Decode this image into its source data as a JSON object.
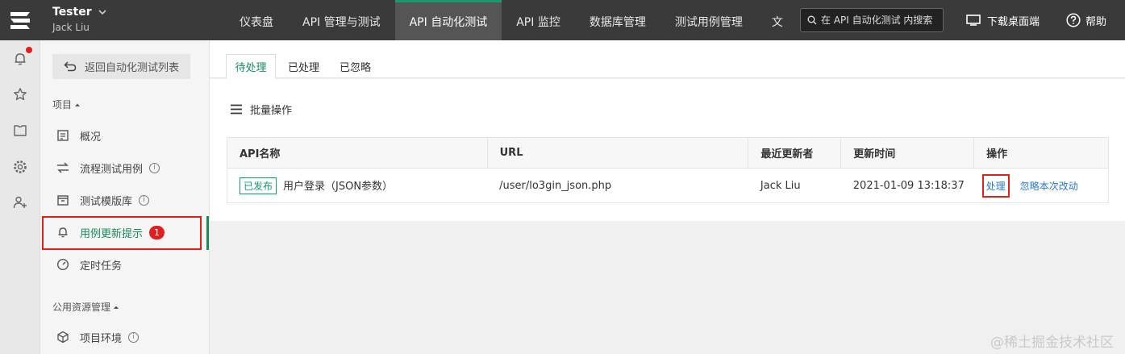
{
  "header": {
    "space_name": "Tester",
    "space_user": "Jack Liu",
    "nav": [
      "仪表盘",
      "API 管理与测试",
      "API 自动化测试",
      "API 监控",
      "数据库管理",
      "测试用例管理",
      "文"
    ],
    "search_placeholder": "在 API 自动化测试 内搜索",
    "download_label": "下载桌面端",
    "help_label": "帮助"
  },
  "sidebar": {
    "back_label": "返回自动化测试列表",
    "section_project": "项目",
    "section_public": "公用资源管理",
    "items": [
      {
        "label": "概况"
      },
      {
        "label": "流程测试用例"
      },
      {
        "label": "测试模版库"
      },
      {
        "label": "用例更新提示",
        "count": "1"
      },
      {
        "label": "定时任务"
      },
      {
        "label": "项目环境"
      }
    ]
  },
  "main": {
    "tabs": [
      "待处理",
      "已处理",
      "已忽略"
    ],
    "batch_label": "批量操作",
    "table": {
      "columns": [
        "API名称",
        "URL",
        "最近更新者",
        "更新时间",
        "操作"
      ],
      "rows": [
        {
          "status": "已发布",
          "name": "用户登录（JSON参数）",
          "url": "/user/lo3gin_json.php",
          "updater": "Jack Liu",
          "time": "2021-01-09 13:18:37",
          "action_process": "处理",
          "action_ignore": "忽略本次改动"
        }
      ]
    }
  },
  "watermark": "@稀土掘金技术社区",
  "colors": {
    "accent": "#1a8a5c",
    "highlight": "#d9241c",
    "link": "#2a7ad2",
    "topbar": "#3a3a3a"
  }
}
